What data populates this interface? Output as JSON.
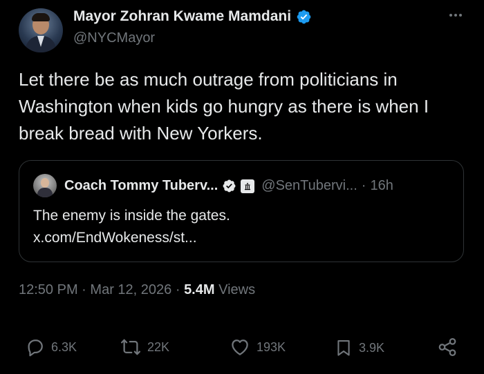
{
  "author": {
    "display_name": "Mayor Zohran Kwame Mamdani",
    "handle": "@NYCMayor",
    "verified_badge_icon": "verified-badge-icon",
    "verified_color": "#1d9bf0"
  },
  "tweet": {
    "text": "Let there be as much outrage from politicians in Washington when kids go hungry as there is when I break bread with New Yorkers."
  },
  "quote": {
    "display_name": "Coach Tommy Tuberv...",
    "handle": "@SenTubervi...",
    "separator": "·",
    "time": "16h",
    "text_line1": "The enemy is inside the gates.",
    "text_line2": "x.com/EndWokeness/st..."
  },
  "meta": {
    "time": "12:50 PM",
    "sep1": "·",
    "date": "Mar 12, 2026",
    "sep2": "·",
    "views_count": "5.4M",
    "views_label": "Views"
  },
  "actions": {
    "replies": "6.3K",
    "reposts": "22K",
    "likes": "193K",
    "bookmarks": "3.9K"
  },
  "colors": {
    "background": "#000000",
    "text_primary": "#e7e9ea",
    "text_secondary": "#71767b",
    "border": "#2f3336"
  }
}
